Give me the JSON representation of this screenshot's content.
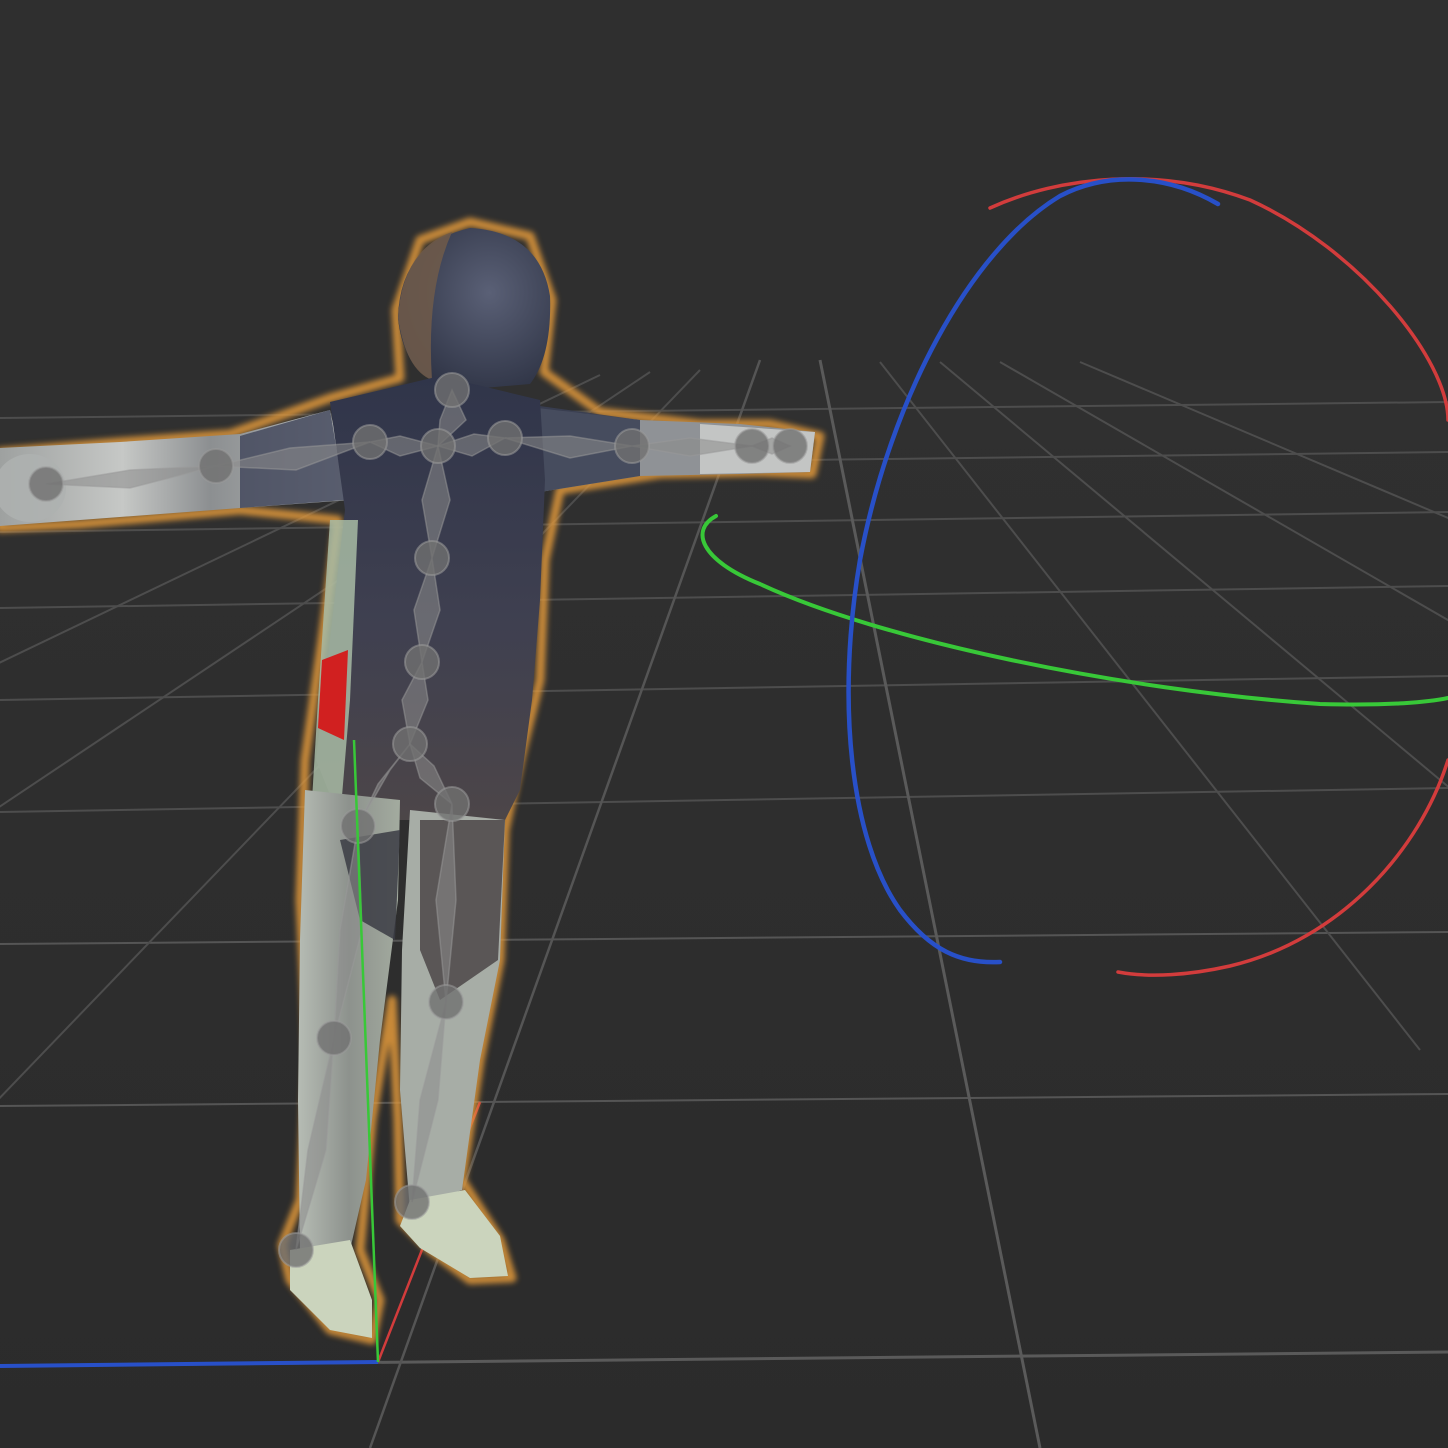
{
  "viewport": {
    "background": "#2f2f2f",
    "grid_color": "#4d4d4d",
    "grid_major_color": "#5a5a5a",
    "selection_outline_color": "#e39a3b",
    "bone_color": "#8c8c8c",
    "joint_color": "#6e6e6e"
  },
  "axes": {
    "x_color": "#d23c3c",
    "y_color": "#38c838",
    "z_color": "#2850c8"
  },
  "rotation_gizmo": {
    "x_ring_color": "#d23c3c",
    "y_ring_color": "#38c838",
    "z_ring_color": "#2850c8"
  },
  "armature": {
    "bone_count": 20,
    "pose": "T-pose"
  },
  "mesh": {
    "torso_color": "#3c4050",
    "limb_color": "#a9adab",
    "foot_color": "#cbd4bd",
    "accent_color": "#d12020"
  }
}
